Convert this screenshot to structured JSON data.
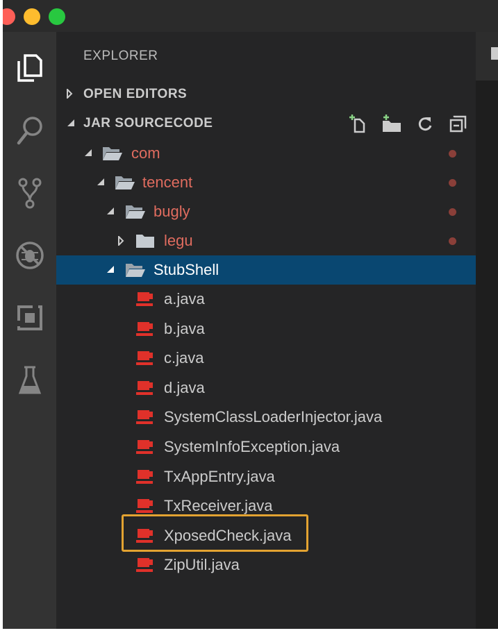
{
  "sidebar": {
    "title": "EXPLORER",
    "sections": {
      "open_editors": "OPEN EDITORS",
      "project": "JAR SOURCECODE"
    }
  },
  "tree": {
    "com": "com",
    "tencent": "tencent",
    "bugly": "bugly",
    "legu": "legu",
    "stubshell": "StubShell",
    "files": [
      "a.java",
      "b.java",
      "c.java",
      "d.java",
      "SystemClassLoaderInjector.java",
      "SystemInfoException.java",
      "TxAppEntry.java",
      "TxReceiver.java",
      "XposedCheck.java",
      "ZipUtil.java"
    ]
  },
  "colors": {
    "folder_text": "#e06c5f",
    "java_icon": "#e0312a",
    "selection": "#094771",
    "highlight": "#e3a331"
  },
  "icons": {
    "activity_bar": [
      "explorer-icon",
      "search-icon",
      "source-control-icon",
      "debug-icon",
      "extensions-icon",
      "test-icon"
    ],
    "section_actions": [
      "new-file-icon",
      "new-folder-icon",
      "refresh-icon",
      "collapse-all-icon"
    ]
  }
}
